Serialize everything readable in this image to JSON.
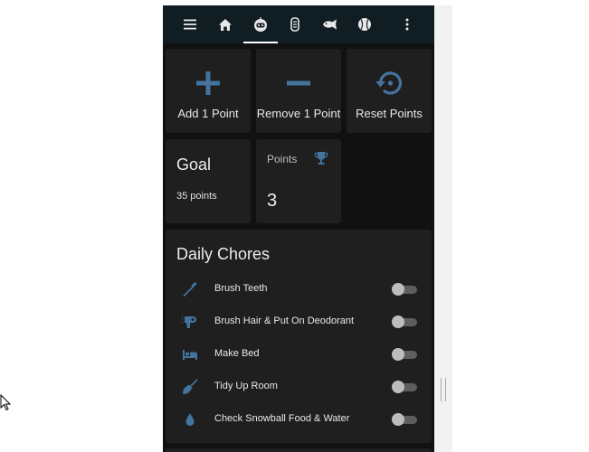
{
  "toolbar": {
    "menu_icon": "menu-icon",
    "home_icon": "home-icon",
    "tabs": [
      "robot-face-icon",
      "hockey-goalie-icon",
      "fish-icon",
      "baseball-icon"
    ],
    "more_icon": "more-vertical-icon",
    "active_tab": "robot-face-icon"
  },
  "actions": [
    {
      "label": "Add 1 Point",
      "icon": "plus-icon"
    },
    {
      "label": "Remove 1 Point",
      "icon": "minus-icon"
    },
    {
      "label": "Reset Points",
      "icon": "restore-icon"
    }
  ],
  "goal": {
    "title": "Goal",
    "subtitle": "35 points"
  },
  "points": {
    "title": "Points",
    "value": "3",
    "icon": "trophy-icon"
  },
  "chores": {
    "title": "Daily Chores",
    "items": [
      {
        "label": "Brush Teeth",
        "icon": "toothbrush-icon",
        "on": false
      },
      {
        "label": "Brush Hair & Put On Deodorant",
        "icon": "hair-dryer-icon",
        "on": false
      },
      {
        "label": "Make Bed",
        "icon": "bed-icon",
        "on": false
      },
      {
        "label": "Tidy Up Room",
        "icon": "broom-icon",
        "on": false
      },
      {
        "label": "Check Snowball Food & Water",
        "icon": "water-drop-icon",
        "on": false
      }
    ]
  },
  "colors": {
    "accent": "#44739e",
    "topbar": "#101e24",
    "card": "#1f1f1f",
    "background": "#111111"
  }
}
